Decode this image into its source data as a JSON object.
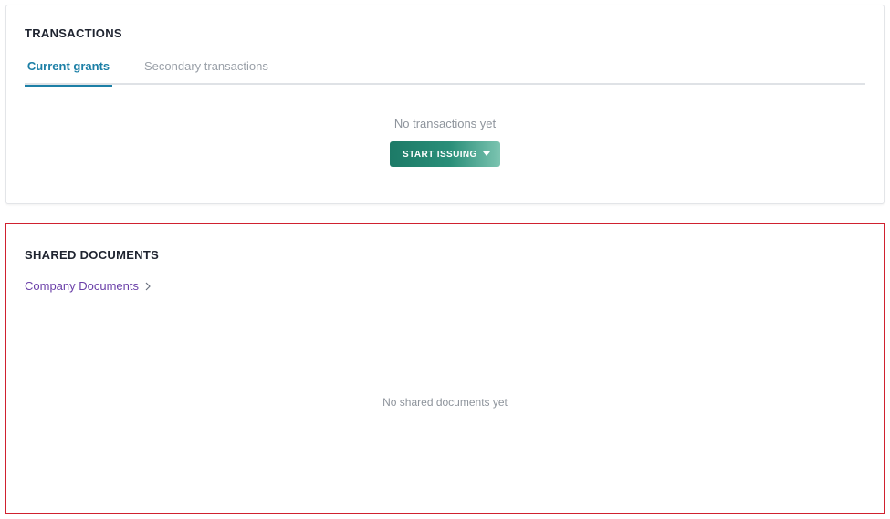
{
  "transactions": {
    "title": "TRANSACTIONS",
    "tabs": [
      {
        "label": "Current grants",
        "active": true
      },
      {
        "label": "Secondary transactions",
        "active": false
      }
    ],
    "empty_message": "No transactions yet",
    "start_button": {
      "label": "START ISSUING",
      "icon": "caret-down-icon"
    }
  },
  "shared_documents": {
    "title": "SHARED DOCUMENTS",
    "link": {
      "label": "Company Documents",
      "icon": "chevron-right-icon"
    },
    "empty_message": "No shared documents yet"
  },
  "colors": {
    "accent_tab": "#1c7fa6",
    "button_start": "#1d7a67",
    "button_end": "#7cc4b1",
    "link": "#6a3fa8",
    "highlight_border": "#d0212f"
  }
}
